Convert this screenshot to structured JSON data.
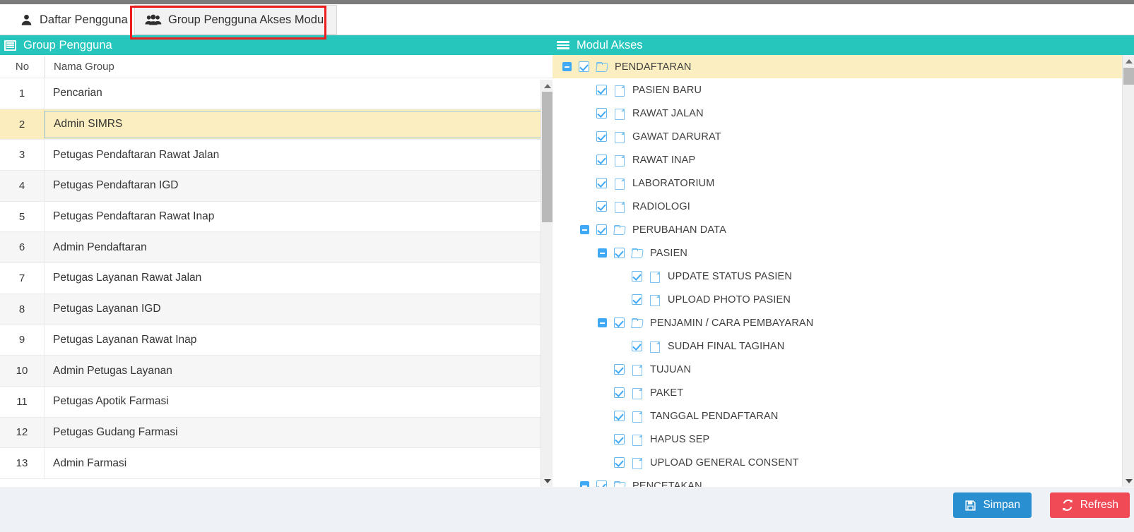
{
  "colors": {
    "teal": "#26c6bd",
    "highlight_yellow": "#fbeec0",
    "accent_blue": "#3fa9f5",
    "save_blue": "#2a8fd0",
    "refresh_red": "#ef4a56",
    "annotation_red": "#ee1c1c",
    "footer_bg": "#eef1f6"
  },
  "tabs": [
    {
      "id": "daftar-pengguna",
      "label": "Daftar Pengguna",
      "icon": "user-icon",
      "active": false
    },
    {
      "id": "group-pengguna-akses-modul",
      "label": "Group Pengguna Akses Modul",
      "icon": "users-group-icon",
      "active": true
    }
  ],
  "left_panel": {
    "title": "Group Pengguna",
    "icon": "list-grid-icon",
    "columns": [
      "No",
      "Nama Group"
    ],
    "rows": [
      {
        "no": "1",
        "name": "Pencarian",
        "selected": false
      },
      {
        "no": "2",
        "name": "Admin SIMRS",
        "selected": true
      },
      {
        "no": "3",
        "name": "Petugas Pendaftaran Rawat Jalan",
        "selected": false
      },
      {
        "no": "4",
        "name": "Petugas Pendaftaran IGD",
        "selected": false
      },
      {
        "no": "5",
        "name": "Petugas Pendaftaran Rawat Inap",
        "selected": false
      },
      {
        "no": "6",
        "name": "Admin Pendaftaran",
        "selected": false
      },
      {
        "no": "7",
        "name": "Petugas Layanan Rawat Jalan",
        "selected": false
      },
      {
        "no": "8",
        "name": "Petugas Layanan IGD",
        "selected": false
      },
      {
        "no": "9",
        "name": "Petugas Layanan Rawat Inap",
        "selected": false
      },
      {
        "no": "10",
        "name": "Admin Petugas Layanan",
        "selected": false
      },
      {
        "no": "11",
        "name": "Petugas Apotik Farmasi",
        "selected": false
      },
      {
        "no": "12",
        "name": "Petugas Gudang Farmasi",
        "selected": false
      },
      {
        "no": "13",
        "name": "Admin Farmasi",
        "selected": false
      }
    ]
  },
  "right_panel": {
    "title": "Modul Akses",
    "icon": "hamburger-icon",
    "tree": [
      {
        "label": "PENDAFTARAN",
        "depth": 0,
        "type": "folder",
        "checked": true,
        "expanded": true,
        "highlighted": true
      },
      {
        "label": "PASIEN BARU",
        "depth": 1,
        "type": "file",
        "checked": true,
        "expanded": null,
        "highlighted": false
      },
      {
        "label": "RAWAT JALAN",
        "depth": 1,
        "type": "file",
        "checked": true,
        "expanded": null,
        "highlighted": false
      },
      {
        "label": "GAWAT DARURAT",
        "depth": 1,
        "type": "file",
        "checked": true,
        "expanded": null,
        "highlighted": false
      },
      {
        "label": "RAWAT INAP",
        "depth": 1,
        "type": "file",
        "checked": true,
        "expanded": null,
        "highlighted": false
      },
      {
        "label": "LABORATORIUM",
        "depth": 1,
        "type": "file",
        "checked": true,
        "expanded": null,
        "highlighted": false
      },
      {
        "label": "RADIOLOGI",
        "depth": 1,
        "type": "file",
        "checked": true,
        "expanded": null,
        "highlighted": false
      },
      {
        "label": "PERUBAHAN DATA",
        "depth": 1,
        "type": "folder",
        "checked": true,
        "expanded": true,
        "highlighted": false
      },
      {
        "label": "PASIEN",
        "depth": 2,
        "type": "folder",
        "checked": true,
        "expanded": true,
        "highlighted": false
      },
      {
        "label": "UPDATE STATUS PASIEN",
        "depth": 3,
        "type": "file",
        "checked": true,
        "expanded": null,
        "highlighted": false
      },
      {
        "label": "UPLOAD PHOTO PASIEN",
        "depth": 3,
        "type": "file",
        "checked": true,
        "expanded": null,
        "highlighted": false
      },
      {
        "label": "PENJAMIN / CARA PEMBAYARAN",
        "depth": 2,
        "type": "folder",
        "checked": true,
        "expanded": true,
        "highlighted": false
      },
      {
        "label": "SUDAH FINAL TAGIHAN",
        "depth": 3,
        "type": "file",
        "checked": true,
        "expanded": null,
        "highlighted": false
      },
      {
        "label": "TUJUAN",
        "depth": 2,
        "type": "file",
        "checked": true,
        "expanded": null,
        "highlighted": false
      },
      {
        "label": "PAKET",
        "depth": 2,
        "type": "file",
        "checked": true,
        "expanded": null,
        "highlighted": false
      },
      {
        "label": "TANGGAL PENDAFTARAN",
        "depth": 2,
        "type": "file",
        "checked": true,
        "expanded": null,
        "highlighted": false
      },
      {
        "label": "HAPUS SEP",
        "depth": 2,
        "type": "file",
        "checked": true,
        "expanded": null,
        "highlighted": false
      },
      {
        "label": "UPLOAD GENERAL CONSENT",
        "depth": 2,
        "type": "file",
        "checked": true,
        "expanded": null,
        "highlighted": false
      },
      {
        "label": "PENCETAKAN",
        "depth": 1,
        "type": "folder",
        "checked": true,
        "expanded": true,
        "highlighted": false
      }
    ]
  },
  "footer": {
    "save_label": "Simpan",
    "save_icon": "floppy-save-icon",
    "refresh_label": "Refresh",
    "refresh_icon": "refresh-arrows-icon"
  }
}
